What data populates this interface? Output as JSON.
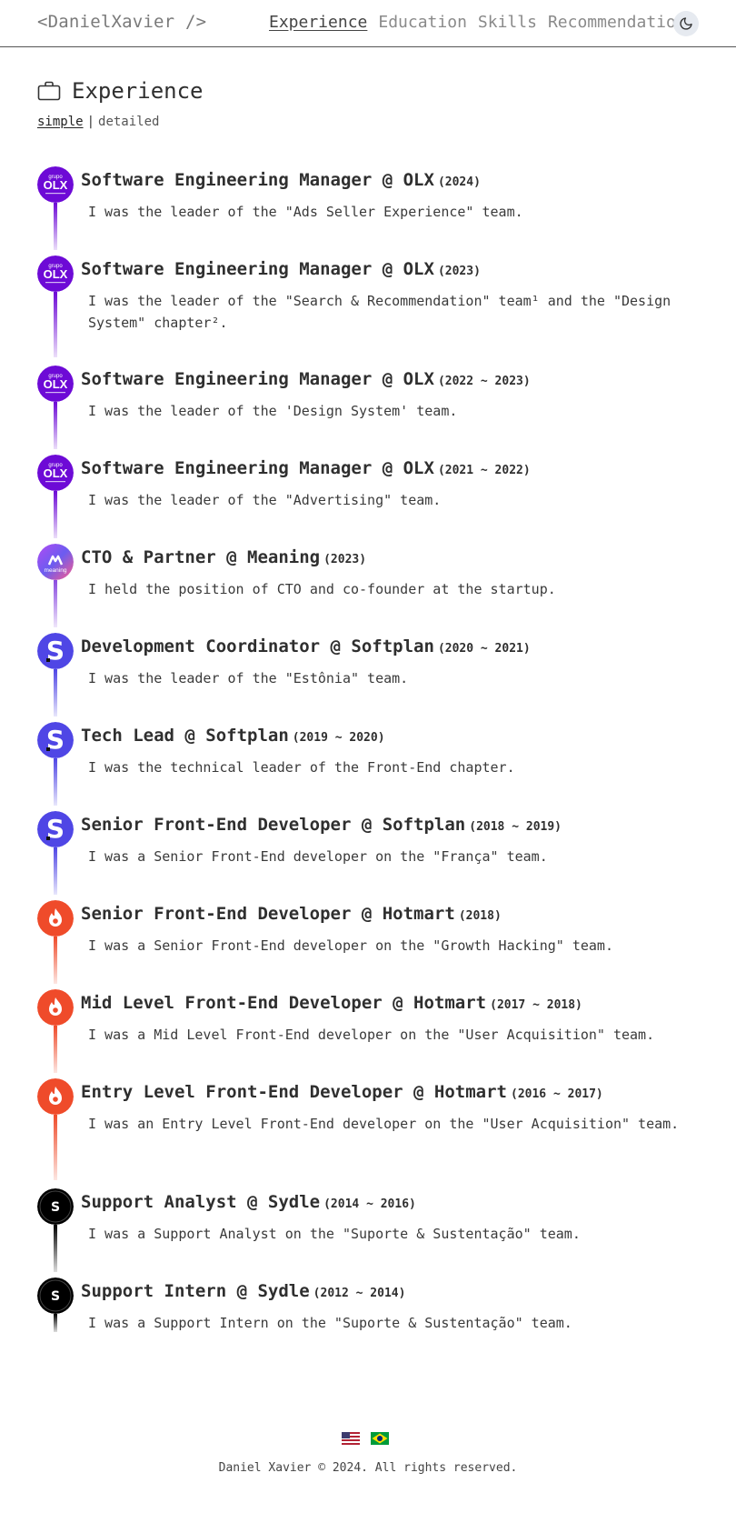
{
  "header": {
    "logo": "<DanielXavier />",
    "nav": [
      "Experience",
      "Education",
      "Skills",
      "Recommendations"
    ],
    "active_nav": "Experience",
    "theme_icon": "moon-icon"
  },
  "section": {
    "icon": "briefcase-icon",
    "title": "Experience",
    "views": [
      "simple",
      "detailed"
    ],
    "separator": "|",
    "active_view": "simple"
  },
  "experience": [
    {
      "role": "Software Engineering Manager @ OLX",
      "period": "(2024)",
      "description": "I was the leader of the \"Ads Seller Experience\" team.",
      "logo": "olx-logo",
      "color": "#6d0ad6"
    },
    {
      "role": "Software Engineering Manager @ OLX",
      "period": "(2023)",
      "description": "I was the leader of the \"Search & Recommendation\" team¹ and the \"Design System\" chapter².",
      "logo": "olx-logo",
      "color": "#6d0ad6"
    },
    {
      "role": "Software Engineering Manager @ OLX",
      "period": "(2022 ~ 2023)",
      "description": "I was the leader of the 'Design System' team.",
      "logo": "olx-logo",
      "color": "#6d0ad6"
    },
    {
      "role": "Software Engineering Manager @ OLX",
      "period": "(2021 ~ 2022)",
      "description": "I was the leader of the \"Advertising\" team.",
      "logo": "olx-logo",
      "color": "#6d0ad6"
    },
    {
      "role": "CTO & Partner @ Meaning",
      "period": "(2023)",
      "description": "I held the position of CTO and co-founder at the startup.",
      "logo": "meaning-logo",
      "color": "#8a4be0"
    },
    {
      "role": "Development Coordinator @ Softplan",
      "period": "(2020 ~ 2021)",
      "description": "I was the leader of the \"Estônia\" team.",
      "logo": "softplan-logo",
      "color": "#4f46e5"
    },
    {
      "role": "Tech Lead @ Softplan",
      "period": "(2019 ~ 2020)",
      "description": "I was the technical leader of the Front-End chapter.",
      "logo": "softplan-logo",
      "color": "#4f46e5"
    },
    {
      "role": "Senior Front-End Developer @ Softplan",
      "period": "(2018 ~ 2019)",
      "description": "I was a Senior Front-End developer on the \"França\" team.",
      "logo": "softplan-logo",
      "color": "#4f46e5"
    },
    {
      "role": "Senior Front-End Developer @ Hotmart",
      "period": "(2018)",
      "description": "I was a Senior Front-End developer on the \"Growth Hacking\" team.",
      "logo": "hotmart-logo",
      "color": "#ef4b2a"
    },
    {
      "role": "Mid Level Front-End Developer @ Hotmart",
      "period": "(2017 ~ 2018)",
      "description": "I was a Mid Level Front-End developer on the \"User Acquisition\" team.",
      "logo": "hotmart-logo",
      "color": "#ef4b2a"
    },
    {
      "role": "Entry Level Front-End Developer @ Hotmart",
      "period": "(2016 ~ 2017)",
      "description": "I was an Entry Level Front-End developer on the \"User Acquisition\" team.",
      "logo": "hotmart-logo",
      "color": "#ef4b2a"
    },
    {
      "role": "Support Analyst @ Sydle",
      "period": "(2014 ~ 2016)",
      "description": "I was a Support Analyst on the \"Suporte & Sustentação\" team.",
      "logo": "sydle-logo",
      "color": "#000000"
    },
    {
      "role": "Support Intern @ Sydle",
      "period": "(2012 ~ 2014)",
      "description": "I was a Support Intern on the \"Suporte & Sustentação\" team.",
      "logo": "sydle-logo",
      "color": "#000000"
    }
  ],
  "logos": {
    "olx": {
      "top": "grupo",
      "main": "OLX"
    },
    "meaning": {
      "text": "meaning"
    },
    "softplan": {
      "letter": "S"
    },
    "sydle": {
      "letter": "S"
    }
  },
  "footer": {
    "languages": [
      "us-flag-icon",
      "brazil-flag-icon"
    ],
    "copyright": "Daniel Xavier © 2024. All rights reserved."
  }
}
